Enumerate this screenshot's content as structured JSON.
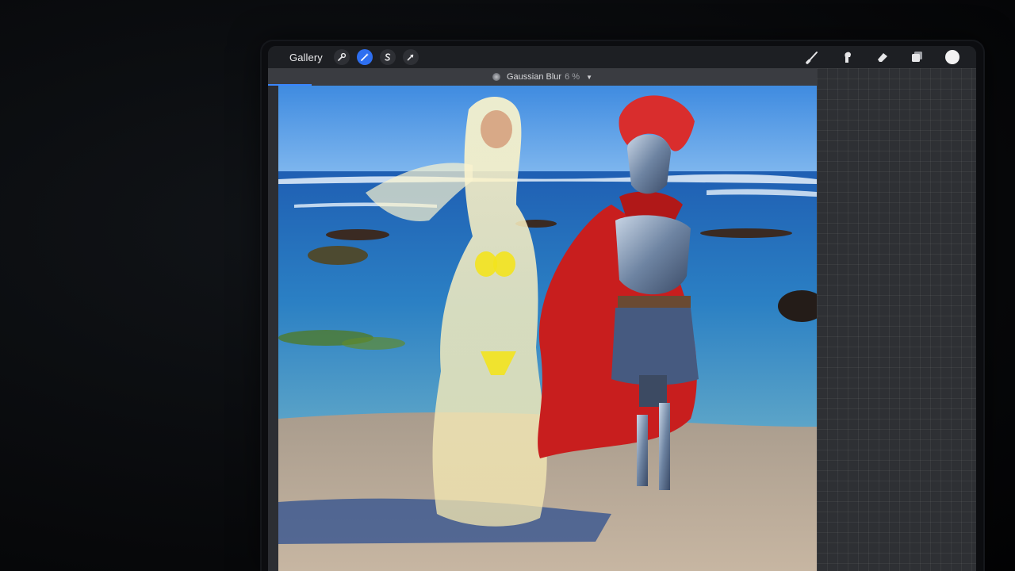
{
  "toolbar": {
    "gallery_label": "Gallery",
    "left_tools": [
      {
        "name": "actions",
        "icon": "wrench-icon",
        "active": false
      },
      {
        "name": "adjustments",
        "icon": "magic-wand-icon",
        "active": true
      },
      {
        "name": "selection",
        "icon": "selection-s-icon",
        "active": false
      },
      {
        "name": "transform",
        "icon": "arrow-cursor-icon",
        "active": false
      }
    ],
    "right_tools": [
      "brush-icon",
      "smudge-icon",
      "eraser-icon",
      "layers-icon",
      "color-icon"
    ]
  },
  "status": {
    "effect_name": "Gaussian Blur",
    "percent": "6 %",
    "progress_fraction": 0.08
  },
  "colors": {
    "accent": "#2e6ff0",
    "toolbar_bg": "#1d1f23",
    "active_color": "#f2f2f2"
  }
}
